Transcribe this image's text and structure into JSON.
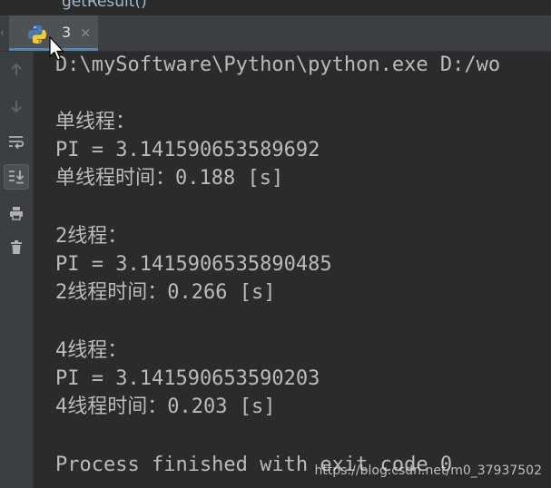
{
  "editor": {
    "breadcrumb": "getResult()"
  },
  "tabs": {
    "items": [
      {
        "label": "3",
        "icon": "python-icon",
        "close": "×",
        "active": true
      }
    ]
  },
  "toolbar": {
    "icons": [
      "arrow-up-icon",
      "arrow-down-icon",
      "soft-wrap-icon",
      "scroll-to-end-icon",
      "print-icon",
      "trash-icon"
    ]
  },
  "console": {
    "lines": [
      "D:\\mySoftware\\Python\\python.exe D:/wo",
      "",
      "单线程：",
      "PI = 3.141590653589692",
      "单线程时间：0.188 [s]",
      "",
      "2线程：",
      "PI = 3.1415906535890485",
      "2线程时间：0.266 [s]",
      "",
      "4线程：",
      "PI = 3.141590653590203",
      "4线程时间：0.203 [s]",
      "",
      "Process finished with exit code 0"
    ]
  },
  "watermark": "https://blog.csdn.net/m0_37937502",
  "colors": {
    "background": "#2b2b2b",
    "panel": "#3c3f41",
    "text": "#bbbbbb",
    "tab_accent": "#4a88c7"
  }
}
